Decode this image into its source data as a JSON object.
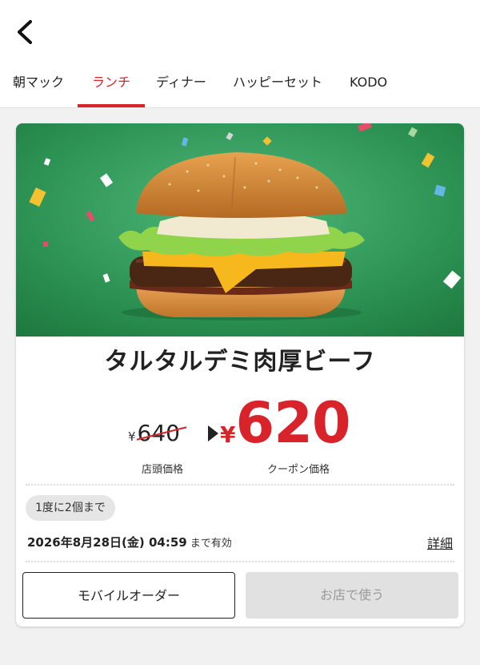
{
  "nav": {
    "back_icon": "chevron-left-icon"
  },
  "tabs": [
    {
      "label": "朝マック",
      "active": false
    },
    {
      "label": "ランチ",
      "active": true
    },
    {
      "label": "ディナー",
      "active": false
    },
    {
      "label": "ハッピーセット",
      "active": false
    },
    {
      "label": "KODO",
      "active": false
    }
  ],
  "coupon": {
    "image": "burger-on-green-confetti-background",
    "name": "タルタルデミ肉厚ビーフ",
    "currency": "¥",
    "old_price": "640",
    "old_price_label": "店頭価格",
    "new_price": "620",
    "new_price_label": "クーポン価格",
    "limit_badge": "1度に2個まで",
    "expiry_date": "2026年8月28日(金) 04:59",
    "expiry_suffix": "まで有効",
    "detail_link": "詳細",
    "mobile_order_button": "モバイルオーダー",
    "use_in_store_button": "お店で使う"
  },
  "colors": {
    "accent": "#d8232a",
    "hero_background": "#2b8f4e",
    "disabled_button": "#e1e1e1"
  }
}
